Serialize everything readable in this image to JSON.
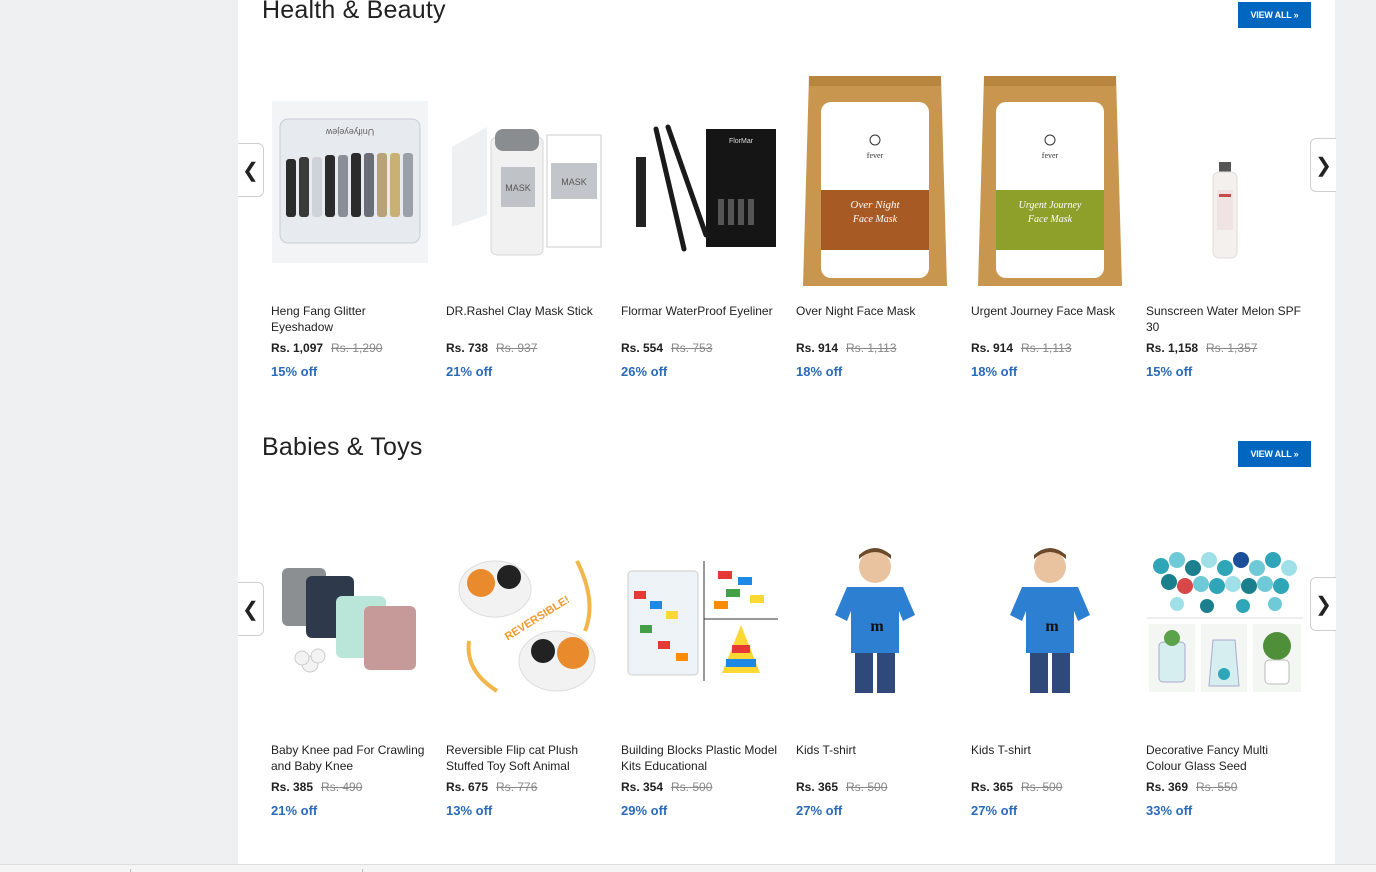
{
  "sections": [
    {
      "title": "Health & Beauty",
      "view_all": "VIEW ALL »",
      "prev_arrow": "❮",
      "next_arrow": "❯",
      "products": [
        {
          "name": "Heng Fang Glitter Eyeshadow",
          "price": "Rs. 1,097",
          "old_price": "Rs. 1,290",
          "discount": "15% off"
        },
        {
          "name": "DR.Rashel Clay Mask Stick",
          "price": "Rs. 738",
          "old_price": "Rs. 937",
          "discount": "21% off"
        },
        {
          "name": "Flormar WaterProof Eyeliner",
          "price": "Rs. 554",
          "old_price": "Rs. 753",
          "discount": "26% off"
        },
        {
          "name": "Over Night Face Mask",
          "price": "Rs. 914",
          "old_price": "Rs. 1,113",
          "discount": "18% off"
        },
        {
          "name": "Urgent Journey Face Mask",
          "price": "Rs. 914",
          "old_price": "Rs. 1,113",
          "discount": "18% off"
        },
        {
          "name": "Sunscreen Water Melon SPF 30",
          "price": "Rs. 1,158",
          "old_price": "Rs. 1,357",
          "discount": "15% off"
        }
      ]
    },
    {
      "title": "Babies & Toys",
      "view_all": "VIEW ALL »",
      "prev_arrow": "❮",
      "next_arrow": "❯",
      "products": [
        {
          "name": "Baby Knee pad For Crawling and Baby Knee",
          "price": "Rs. 385",
          "old_price": "Rs. 490",
          "discount": "21% off"
        },
        {
          "name": "Reversible Flip cat Plush Stuffed Toy Soft Animal",
          "price": "Rs. 675",
          "old_price": "Rs. 776",
          "discount": "13% off"
        },
        {
          "name": "Building Blocks Plastic Model Kits Educational",
          "price": "Rs. 354",
          "old_price": "Rs. 500",
          "discount": "29% off"
        },
        {
          "name": "Kids T-shirt",
          "price": "Rs. 365",
          "old_price": "Rs. 500",
          "discount": "27% off"
        },
        {
          "name": "Kids T-shirt",
          "price": "Rs. 365",
          "old_price": "Rs. 500",
          "discount": "27% off"
        },
        {
          "name": "Decorative Fancy Multi Colour Glass Seed",
          "price": "Rs. 369",
          "old_price": "Rs. 550",
          "discount": "33% off"
        }
      ]
    }
  ],
  "image_labels": {
    "eyeliner_box": "FlorMar",
    "mask_brand": "fever",
    "mask1_title": "Over Night",
    "mask1_sub": "Face Mask",
    "mask2_title": "Urgent Journey",
    "mask2_sub": "Face Mask",
    "tshirt_logo": "m",
    "reversible": "REVERSIBLE!"
  }
}
